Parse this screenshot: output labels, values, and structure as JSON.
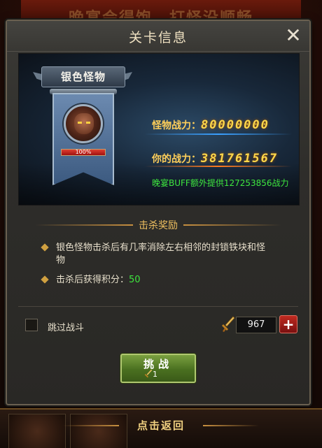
{
  "background": {
    "banner_text": "晚宴会得饱，打怪没顺畅"
  },
  "dialog": {
    "title": "关卡信息",
    "close_icon": "close-icon"
  },
  "monster": {
    "name": "银色怪物",
    "hp_percent": 100,
    "hp_text": "100%"
  },
  "stats": {
    "monster_power_label": "怪物战力：",
    "monster_power_value": "80000000",
    "your_power_label": "你的战力：",
    "your_power_value": "381761567",
    "buff_text": "晚宴BUFF额外提供127253856战力"
  },
  "rewards": {
    "title": "击杀奖励",
    "items": [
      {
        "text": "银色怪物击杀后有几率消除左右相邻的封锁铁块和怪物"
      },
      {
        "text": "击杀后获得积分：",
        "value": "50"
      }
    ]
  },
  "skip": {
    "label": "跳过战斗",
    "checked": false
  },
  "resource": {
    "icon": "sword-icon",
    "count": "967",
    "plus_label": "+"
  },
  "challenge": {
    "label": "挑战",
    "cost": "1"
  },
  "bottom": {
    "return_label": "点击返回"
  },
  "colors": {
    "accent_gold": "#ffd84a",
    "buff_green": "#3ee63e",
    "button_green": "#4a7020",
    "plus_red": "#c02a20"
  }
}
